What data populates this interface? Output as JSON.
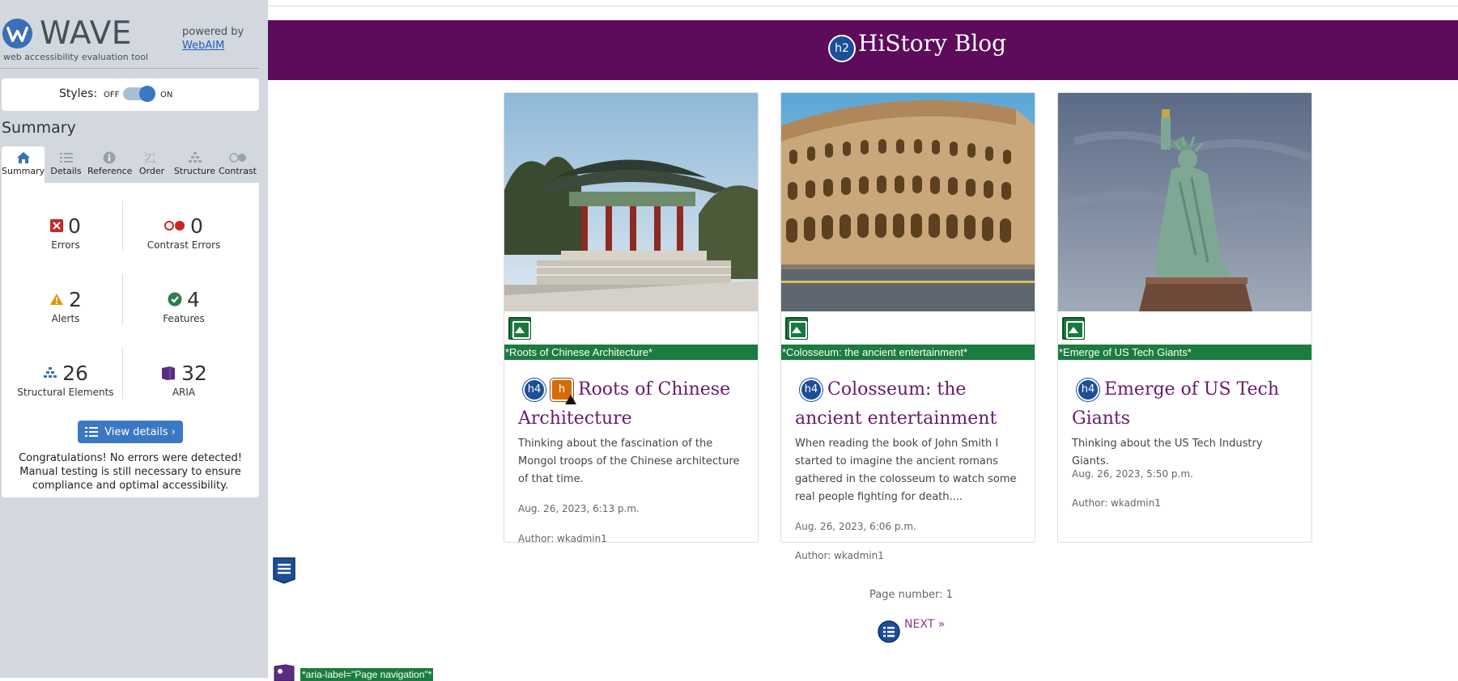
{
  "wave": {
    "logo_text": "WAVE",
    "tagline": "web accessibility evaluation tool",
    "powered_by": "powered by",
    "webaim_link": "WebAIM",
    "styles": {
      "label": "Styles:",
      "off": "OFF",
      "on": "ON",
      "state": "on"
    },
    "summary_title": "Summary",
    "tabs": [
      {
        "label": "Summary",
        "icon": "home-icon",
        "active": true
      },
      {
        "label": "Details",
        "icon": "list-icon"
      },
      {
        "label": "Reference",
        "icon": "info-icon"
      },
      {
        "label": "Order",
        "icon": "order-icon"
      },
      {
        "label": "Structure",
        "icon": "structure-icon"
      },
      {
        "label": "Contrast",
        "icon": "contrast-icon"
      }
    ],
    "stats": {
      "errors": {
        "value": "0",
        "label": "Errors"
      },
      "contrast_errors": {
        "value": "0",
        "label": "Contrast Errors"
      },
      "alerts": {
        "value": "2",
        "label": "Alerts"
      },
      "features": {
        "value": "4",
        "label": "Features"
      },
      "structural": {
        "value": "26",
        "label": "Structural Elements"
      },
      "aria": {
        "value": "32",
        "label": "ARIA"
      }
    },
    "view_details": "View details ›",
    "congrats": "Congratulations! No errors were detected! Manual testing is still necessary to ensure compliance and optimal accessibility."
  },
  "page": {
    "blog_title": "HiStory Blog",
    "h2_badge": "h2",
    "cards": [
      {
        "alt": "*Roots of Chinese Architecture*",
        "title": "Roots of Chinese Architecture",
        "text": "Thinking about the fascination of the Mongol troops of the Chinese architecture of that time.",
        "date": "Aug. 26, 2023, 6:13 p.m.",
        "author": "Author: wkadmin1"
      },
      {
        "alt": "*Colosseum: the ancient entertainment*",
        "title": "Colosseum: the ancient entertainment",
        "text": "When reading the book of John Smith I started to imagine the ancient romans gathered in the colosseum to watch some real people fighting for death....",
        "date": "Aug. 26, 2023, 6:06 p.m.",
        "author": "Author: wkadmin1"
      },
      {
        "alt": "*Emerge of US Tech Giants*",
        "title": "Emerge of US Tech Giants",
        "text": "Thinking about the US Tech Industry Giants.",
        "date": "Aug. 26, 2023, 5:50 p.m.",
        "author": "Author: wkadmin1"
      }
    ],
    "h4_badge": "h4",
    "h_alert_badge": "h",
    "page_number": "Page number: 1",
    "next": "NEXT »",
    "aria_label": "*aria-label=\"Page navigation\"*"
  },
  "colors": {
    "banner": "#5e0b5c",
    "accent": "#3b78c4",
    "alt_green": "#1b7c3f",
    "link_purple": "#6b1a6b"
  }
}
